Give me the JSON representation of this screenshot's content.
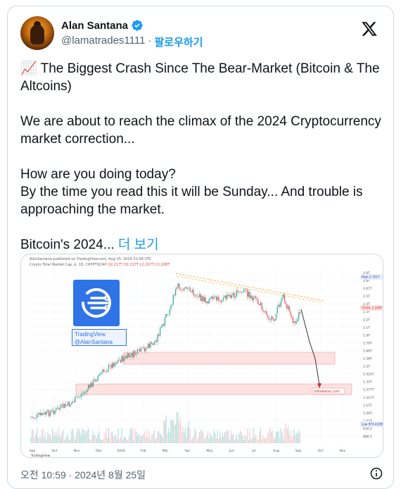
{
  "user": {
    "display_name": "Alan Santana",
    "handle": "@lamatrades1111",
    "separator": "·",
    "follow_label": "팔로우하기"
  },
  "tweet": {
    "emoji": "📈",
    "text_body": "The Biggest Crash Since The Bear-Market (Bitcoin & The Altcoins)\n\nWe are about to reach the climax of the 2024 Cryptocurrency market correction...\n\nHow are you doing today?\nBy the time you read this it will be Sunday... And trouble is approaching the market.\n\nBitcoin's 2024...",
    "show_more": "더 보기"
  },
  "chart_image": {
    "topline": "AlanSantana published on TradingView.com, Aug 25, 2024 01:58 UTC",
    "symbol_line": "Crypto Total Market Cap, $, 1D, CRYPTOCAP",
    "ohlc_values": "O2.217T H2.237T L2.207T C2.208T",
    "tv_label_line1": "TradingView",
    "tv_label_line2": "@AlanSantana",
    "x_axis_labels": [
      "Sep",
      "Oct",
      "Nov",
      "Dec",
      "2024",
      "Feb",
      "Mar",
      "Apr",
      "May",
      "Jun",
      "Jul",
      "Aug",
      "Sep",
      "Oct",
      "Nov"
    ],
    "y_axis_labels": [
      "2.9T",
      "2.8T",
      "2.67T",
      "2.5T",
      "2.4T",
      "2.3T",
      "2.2T",
      "2.1T",
      "1.9T",
      "1.79T",
      "1.68T",
      "1.58T",
      "1.5T",
      "1.425T",
      "1.35T",
      "1.277T",
      "1.217T",
      "1.15T",
      "1.09T",
      "1.03T",
      "930.5",
      "886.5"
    ],
    "high_label": "High",
    "high_value": "2.721T",
    "total_label": "TOTAL",
    "total_value": "2.208T",
    "low_label": "Low",
    "low_value": "973.422B",
    "target_label": "followatan.com",
    "footer_logo": "TradingView"
  },
  "footer": {
    "timestamp": "오전 10:59 · 2024년 8월 25일"
  },
  "colors": {
    "accent": "#1d9bf0",
    "text": "#0f1419",
    "muted": "#536471",
    "candle_up": "#26a69a",
    "candle_down": "#ef5350",
    "zone_fill": "#fde2e2",
    "trendline": "#f5a623"
  }
}
